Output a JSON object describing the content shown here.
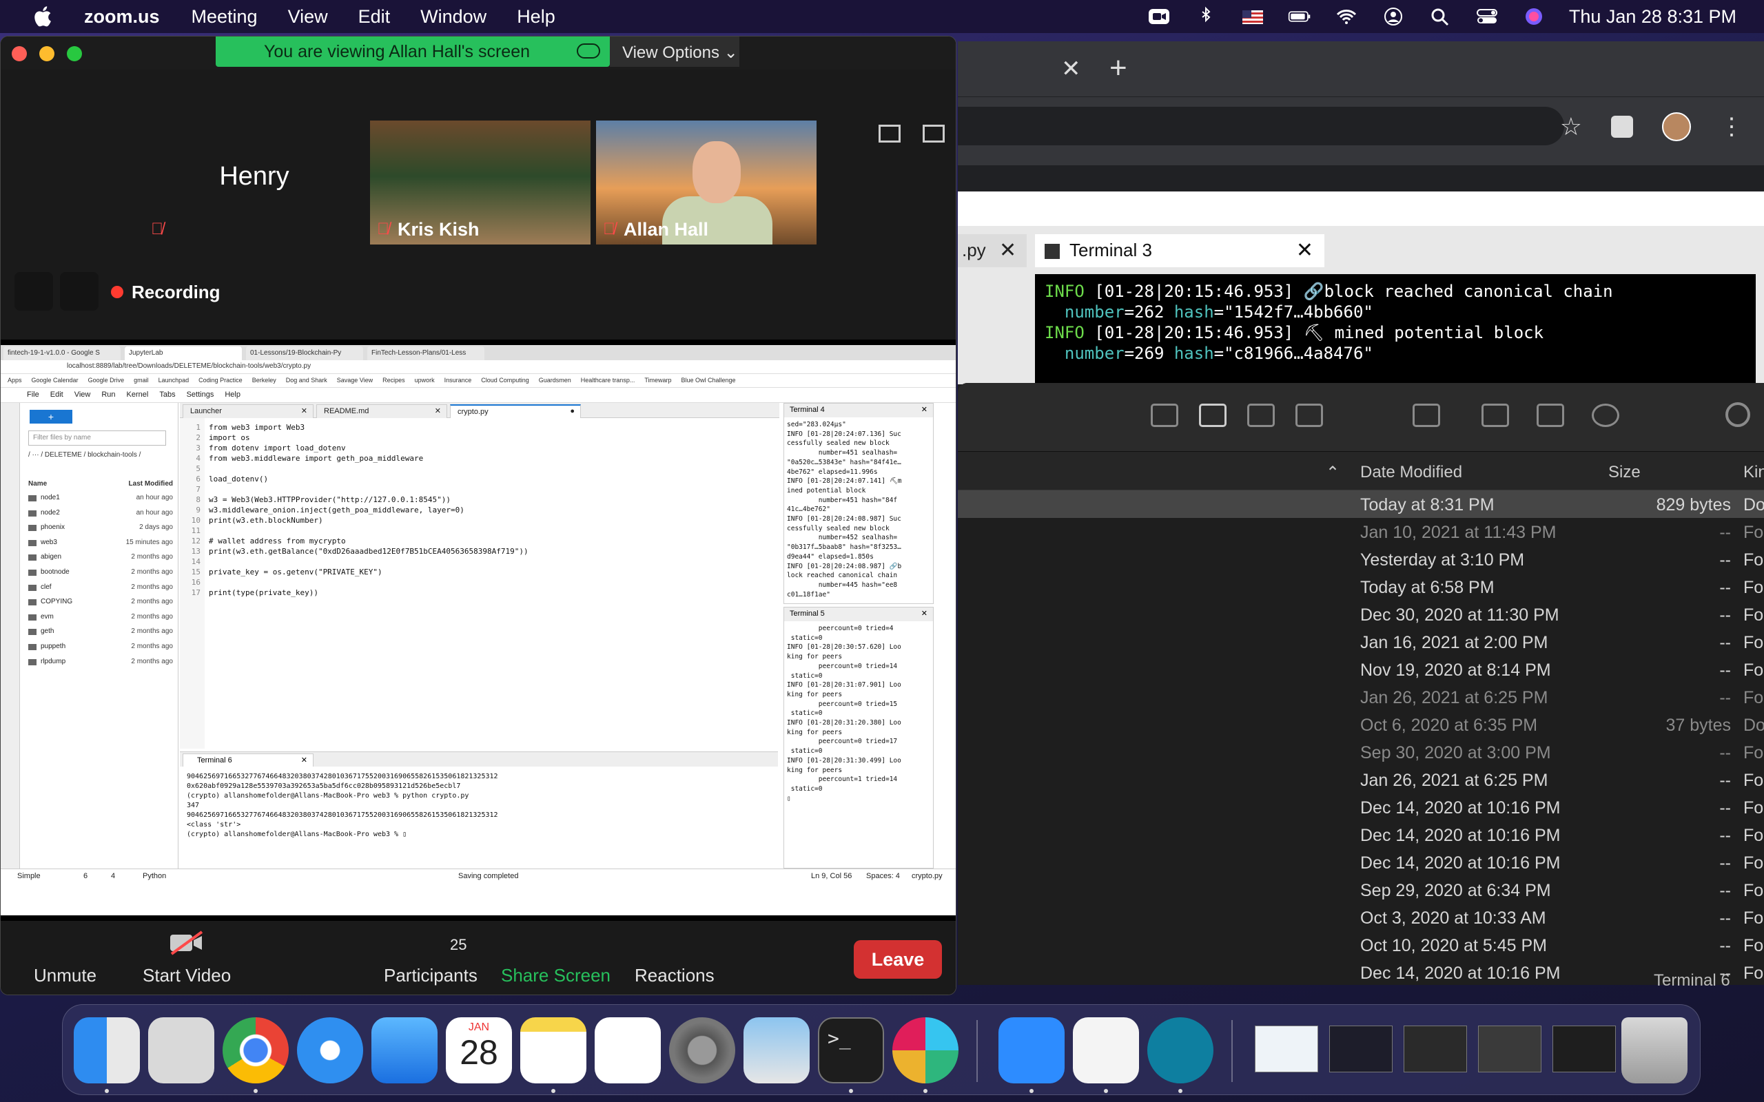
{
  "menubar": {
    "app_name": "zoom.us",
    "menus": [
      "Meeting",
      "View",
      "Edit",
      "Window",
      "Help"
    ],
    "clock": "Thu Jan 28  8:31 PM"
  },
  "zoom": {
    "banner": "You are viewing Allan Hall's screen",
    "view_options": "View Options",
    "participants_tiles": [
      "Henry",
      "Kris Kish",
      "Allan Hall"
    ],
    "recording": "Recording",
    "controls": {
      "unmute": "Unmute",
      "start_video": "Start Video",
      "participants": "Participants",
      "participant_count": "25",
      "share_screen": "Share Screen",
      "reactions": "Reactions",
      "leave": "Leave"
    }
  },
  "shared": {
    "chrome_tabs": [
      "fintech-19-1-v1.0.0 - Google S",
      "JupyterLab",
      "01-Lessons/19-Blockchain-Py",
      "FinTech-Lesson-Plans/01-Less"
    ],
    "url": "localhost:8889/lab/tree/Downloads/DELETEME/blockchain-tools/web3/crypto.py",
    "bookmarks": [
      "Apps",
      "Google Calendar",
      "Google Drive",
      "gmail",
      "Launchpad",
      "Coding Practice",
      "Berkeley",
      "Dog and Shark",
      "Savage View",
      "Recipes",
      "upwork",
      "Insurance",
      "Cloud Computing",
      "Guardsmen",
      "Healthcare transp...",
      "Timewarp",
      "Blue Owl Challenge"
    ],
    "jupyter_menu": [
      "File",
      "Edit",
      "View",
      "Run",
      "Kernel",
      "Tabs",
      "Settings",
      "Help"
    ],
    "filter_placeholder": "Filter files by name",
    "breadcrumb": "/ ··· / DELETEME / blockchain-tools /",
    "file_header": {
      "name": "Name",
      "modified": "Last Modified"
    },
    "files": [
      {
        "name": "node1",
        "modified": "an hour ago"
      },
      {
        "name": "node2",
        "modified": "an hour ago"
      },
      {
        "name": "phoenix",
        "modified": "2 days ago"
      },
      {
        "name": "web3",
        "modified": "15 minutes ago"
      },
      {
        "name": "abigen",
        "modified": "2 months ago"
      },
      {
        "name": "bootnode",
        "modified": "2 months ago"
      },
      {
        "name": "clef",
        "modified": "2 months ago"
      },
      {
        "name": "COPYING",
        "modified": "2 months ago"
      },
      {
        "name": "evm",
        "modified": "2 months ago"
      },
      {
        "name": "geth",
        "modified": "2 months ago"
      },
      {
        "name": "puppeth",
        "modified": "2 months ago"
      },
      {
        "name": "rlpdump",
        "modified": "2 months ago"
      }
    ],
    "editor_tabs": [
      "Launcher",
      "README.md",
      "crypto.py"
    ],
    "code_gutter": "1\n2\n3\n4\n5\n6\n7\n8\n9\n10\n11\n12\n13\n14\n15\n16\n17",
    "code": "from web3 import Web3\nimport os\nfrom dotenv import load_dotenv\nfrom web3.middleware import geth_poa_middleware\n\nload_dotenv()\n\nw3 = Web3(Web3.HTTPProvider(\"http://127.0.0.1:8545\"))\nw3.middleware_onion.inject(geth_poa_middleware, layer=0)\nprint(w3.eth.blockNumber)\n\n# wallet address from mycrypto\nprint(w3.eth.getBalance(\"0xdD26aaadbed12E0f7B51bCEA40563658398Af719\"))\n\nprivate_key = os.getenv(\"PRIVATE_KEY\")\n\nprint(type(private_key))",
    "terminal6_title": "Terminal 6",
    "terminal6": "904625697166532776746648320380374280103671755200316906558261535061821325312\n0x620abf0929a128e5539703a392653a5ba5df6cc028b095893121d526be5ecbl7\n(crypto) allanshomefolder@Allans-MacBook-Pro web3 % python crypto.py\n347\n904625697166532776746648320380374280103671755200316906558261535061821325312\n<class 'str'>\n(crypto) allanshomefolder@Allans-MacBook-Pro web3 % ▯",
    "terminal4_title": "Terminal 4",
    "terminal4": "sed=\"283.024µs\"\nINFO [01-28|20:24:07.136] Suc\ncessfully sealed new block\n        number=451 sealhash=\n\"0a520c…53843e\" hash=\"84f41e…\n4be762\" elapsed=11.996s\nINFO [01-28|20:24:07.141] ⛏m\nined potential block\n        number=451 hash=\"84f\n41c…4be762\"\nINFO [01-28|20:24:08.987] Suc\ncessfully sealed new block\n        number=452 sealhash=\n\"0b317f…5baab8\" hash=\"8f3253…\nd9ea44\" elapsed=1.850s\nINFO [01-28|20:24:08.987] 🔗b\nlock reached canonical chain\n        number=445 hash=\"ee8\nc01…18f1ae\"",
    "terminal5_title": "Terminal 5",
    "terminal5": "        peercount=0 tried=4\n static=0\nINFO [01-28|20:30:57.620] Loo\nking for peers\n        peercount=0 tried=14\n static=0\nINFO [01-28|20:31:07.901] Loo\nking for peers\n        peercount=0 tried=15\n static=0\nINFO [01-28|20:31:20.380] Loo\nking for peers\n        peercount=0 tried=17\n static=0\nINFO [01-28|20:31:30.499] Loo\nking for peers\n        peercount=1 tried=14\n static=0\n▯",
    "status": {
      "mode": "Simple",
      "counts": "6",
      "counts2": "4",
      "lang": "Python",
      "saving": "Saving completed",
      "cursor": "Ln 9, Col 56",
      "spaces": "Spaces: 4",
      "filename": "crypto.py"
    }
  },
  "terminal_window": {
    "tab_left": ".py",
    "tab_title": "Terminal 3",
    "lines": [
      {
        "pre": "INFO ",
        "ts": "[01-28|20:15:46.953] ",
        "msg": "🔗block reached canonical chain"
      },
      {
        "pre": "  ",
        "k1": "number",
        "v1": "=262 ",
        "k2": "hash",
        "v2": "=\"1542f7…4bb660\""
      },
      {
        "pre": "INFO ",
        "ts": "[01-28|20:15:46.953] ",
        "msg": "⛏ mined potential block"
      },
      {
        "pre": "  ",
        "k1": "number",
        "v1": "=269 ",
        "k2": "hash",
        "v2": "=\"c81966…4a8476\""
      }
    ]
  },
  "finder": {
    "columns": {
      "date": "Date Modified",
      "size": "Size",
      "kind": "Kin"
    },
    "rows": [
      {
        "date": "Today at 8:31 PM",
        "size": "829 bytes",
        "kind": "Do",
        "selected": true
      },
      {
        "date": "Jan 10, 2021 at 11:43 PM",
        "size": "--",
        "kind": "Fo",
        "dim": true
      },
      {
        "date": "Yesterday at 3:10 PM",
        "size": "--",
        "kind": "Fo"
      },
      {
        "date": "Today at 6:58 PM",
        "size": "--",
        "kind": "Fo"
      },
      {
        "date": "Dec 30, 2020 at 11:30 PM",
        "size": "--",
        "kind": "Fo"
      },
      {
        "date": "Jan 16, 2021 at 2:00 PM",
        "size": "--",
        "kind": "Fo"
      },
      {
        "date": "Nov 19, 2020 at 8:14 PM",
        "size": "--",
        "kind": "Fo"
      },
      {
        "date": "Jan 26, 2021 at 6:25 PM",
        "size": "--",
        "kind": "Fo",
        "dim": true
      },
      {
        "date": "Oct 6, 2020 at 6:35 PM",
        "size": "37 bytes",
        "kind": "Do",
        "dim": true
      },
      {
        "date": "Sep 30, 2020 at 3:00 PM",
        "size": "--",
        "kind": "Fo",
        "dim": true
      },
      {
        "date": "Jan 26, 2021 at 6:25 PM",
        "size": "--",
        "kind": "Fo"
      },
      {
        "date": "Dec 14, 2020 at 10:16 PM",
        "size": "--",
        "kind": "Fo"
      },
      {
        "date": "Dec 14, 2020 at 10:16 PM",
        "size": "--",
        "kind": "Fo"
      },
      {
        "date": "Dec 14, 2020 at 10:16 PM",
        "size": "--",
        "kind": "Fo"
      },
      {
        "date": "Sep 29, 2020 at 6:34 PM",
        "size": "--",
        "kind": "Fo"
      },
      {
        "date": "Oct 3, 2020 at 10:33 AM",
        "size": "--",
        "kind": "Fo"
      },
      {
        "date": "Oct 10, 2020 at 5:45 PM",
        "size": "--",
        "kind": "Fo"
      },
      {
        "date": "Dec 14, 2020 at 10:16 PM",
        "size": "--",
        "kind": "Fo"
      }
    ],
    "bottom_label": "Terminal 6"
  },
  "dock": {
    "calendar_month": "JAN",
    "calendar_day": "28",
    "apps": [
      "finder",
      "launchpad",
      "chrome",
      "safari",
      "mail",
      "calendar",
      "notes",
      "reminders",
      "system-preferences",
      "preview",
      "terminal",
      "slack",
      "zoom",
      "textedit",
      "wavebox"
    ]
  },
  "colors": {
    "zoom_green": "#27c05c",
    "leave_red": "#d33131",
    "jupyter_blue": "#1976d2"
  }
}
